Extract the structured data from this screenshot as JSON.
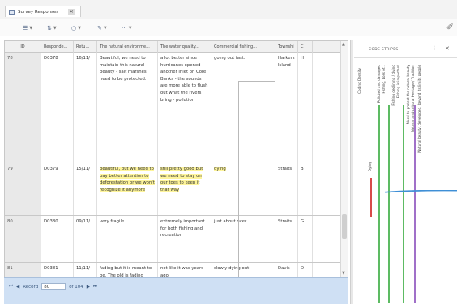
{
  "tab": {
    "label": "Survey Responses",
    "close": "✕"
  },
  "toolbar": {
    "buttons": [
      {
        "glyph": "☰",
        "name": "view"
      },
      {
        "glyph": "⇅",
        "name": "sort"
      },
      {
        "glyph": "○",
        "name": "filter"
      },
      {
        "glyph": "✎",
        "name": "edit"
      },
      {
        "glyph": "···",
        "name": "more"
      }
    ],
    "right_glyph": "✐"
  },
  "grid": {
    "headers": [
      "ID",
      "Responde...",
      "Retu...",
      "The natural environme...",
      "The water quality...",
      "Commercial fishing...",
      "Townshi",
      "C"
    ],
    "rows": [
      {
        "id": "78",
        "resp": "D0378",
        "ret": "16/11/",
        "nat": "Beautiful, we need to maintain this natural beauty - salt marshes need to be protected.",
        "wat": "a lot better since hurricanes opened another inlet on Core Banks - the sounds are more able to flush out what the rivers bring - pollution",
        "com": "going out fast.",
        "town": "Harkers Island",
        "co": "H"
      },
      {
        "id": "79",
        "resp": "D0379",
        "ret": "15/11/",
        "nat": "beautiful, but we need to pay better attention to deforestation or we won't recognize it anymore",
        "wat": "still pretty good but we need to stay on our toes to keep it that way",
        "com": "dying",
        "town": "Straits",
        "co": "B"
      },
      {
        "id": "80",
        "resp": "D0380",
        "ret": "09/11/",
        "nat": "very fragile",
        "wat": "extremely important for both fishing and recreation",
        "com": "just about over",
        "town": "Straits",
        "co": "G"
      },
      {
        "id": "81",
        "resp": "D0381",
        "ret": "11/11/",
        "nat": "fading but it is meant to be. The old is fading",
        "wat": "not like it was years ago",
        "com": "slowly dying out",
        "town": "Davis",
        "co": "D"
      }
    ]
  },
  "navbar": {
    "record_label": "Record",
    "record_value": "80",
    "of_label": "of 104"
  },
  "stripes": {
    "title": "CODE STRIPES",
    "labels": [
      "Coding Density",
      "Polluted and damaged",
      "Fishing, Loss of...",
      "Fishing declining / dying",
      "Fishing is important",
      "Need to protect the natural beauty",
      "Natural and cultural Heritage / Tradition",
      "Natural beauty, developed, beyond its limits people"
    ],
    "short_label": "Dying",
    "colors": {
      "green": "#5dbb63",
      "purple": "#a070c8",
      "red": "#d84a4a",
      "blue": "#3f8fd6"
    }
  }
}
